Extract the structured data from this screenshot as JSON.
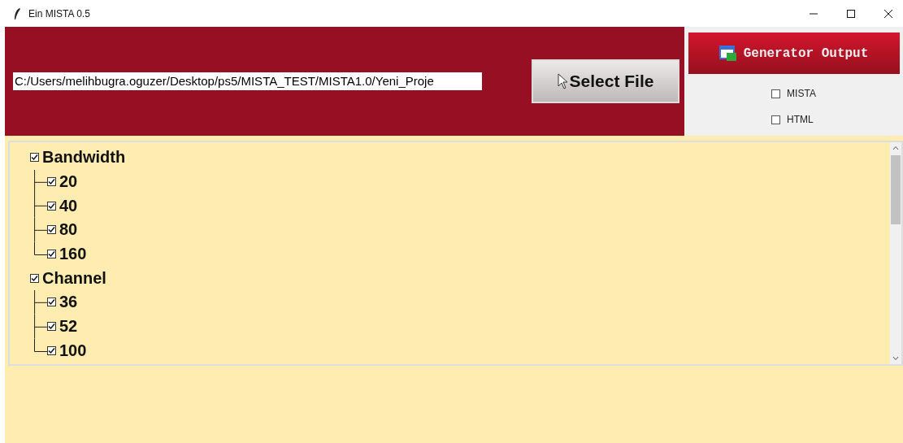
{
  "window": {
    "title": "Ein MISTA 0.5"
  },
  "path_field": {
    "value": "C:/Users/melihbugra.oguzer/Desktop/ps5/MISTA_TEST/MISTA1.0/Yeni_Proje"
  },
  "select_button": {
    "label": "Select File"
  },
  "generator_button": {
    "label": "Generator Output"
  },
  "options": [
    {
      "label": "MISTA",
      "checked": false
    },
    {
      "label": "HTML",
      "checked": false
    }
  ],
  "tree": [
    {
      "label": "Bandwidth",
      "checked": true,
      "children": [
        {
          "label": "20",
          "checked": true
        },
        {
          "label": "40",
          "checked": true
        },
        {
          "label": "80",
          "checked": true
        },
        {
          "label": "160",
          "checked": true
        }
      ]
    },
    {
      "label": "Channel",
      "checked": true,
      "children": [
        {
          "label": "36",
          "checked": true
        },
        {
          "label": "52",
          "checked": true
        },
        {
          "label": "100",
          "checked": true
        }
      ]
    }
  ]
}
